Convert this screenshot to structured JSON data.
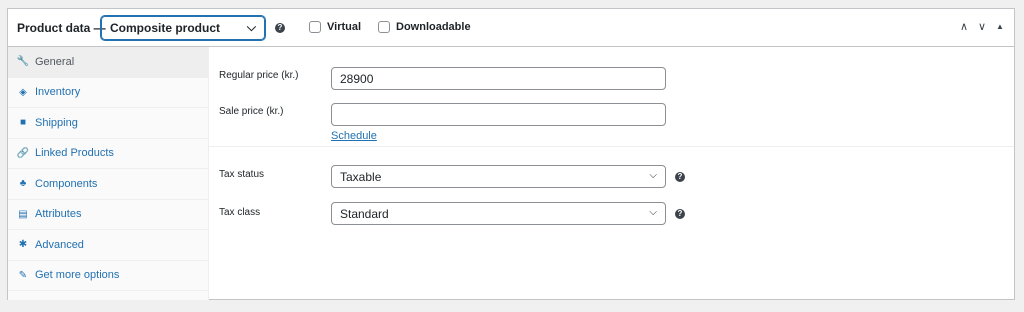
{
  "header": {
    "title": "Product data —",
    "product_type": "Composite product",
    "virtual_label": "Virtual",
    "downloadable_label": "Downloadable"
  },
  "icons": {
    "chevron_down": "⌵",
    "help": "?",
    "move_up": "∧",
    "move_down": "∨",
    "toggle": "▲"
  },
  "sidebar": {
    "tabs": [
      {
        "label": "General",
        "icon": "wrench-icon",
        "glyph": "🔧",
        "active": true
      },
      {
        "label": "Inventory",
        "icon": "tag-icon",
        "glyph": "◈",
        "active": false
      },
      {
        "label": "Shipping",
        "icon": "truck-icon",
        "glyph": "■",
        "active": false
      },
      {
        "label": "Linked Products",
        "icon": "link-icon",
        "glyph": "🔗",
        "active": false
      },
      {
        "label": "Components",
        "icon": "components-icon",
        "glyph": "♣",
        "active": false
      },
      {
        "label": "Attributes",
        "icon": "list-icon",
        "glyph": "▤",
        "active": false
      },
      {
        "label": "Advanced",
        "icon": "gear-icon",
        "glyph": "✱",
        "active": false
      },
      {
        "label": "Get more options",
        "icon": "plugin-icon",
        "glyph": "✎",
        "active": false
      }
    ]
  },
  "general": {
    "regular_price_label": "Regular price (kr.)",
    "regular_price_value": "28900",
    "sale_price_label": "Sale price (kr.)",
    "sale_price_value": "",
    "schedule_link": "Schedule",
    "tax_status_label": "Tax status",
    "tax_status_value": "Taxable",
    "tax_class_label": "Tax class",
    "tax_class_value": "Standard"
  },
  "colors": {
    "accent": "#2271b1",
    "border": "#c3c4c7",
    "background": "#f0f0f1"
  }
}
